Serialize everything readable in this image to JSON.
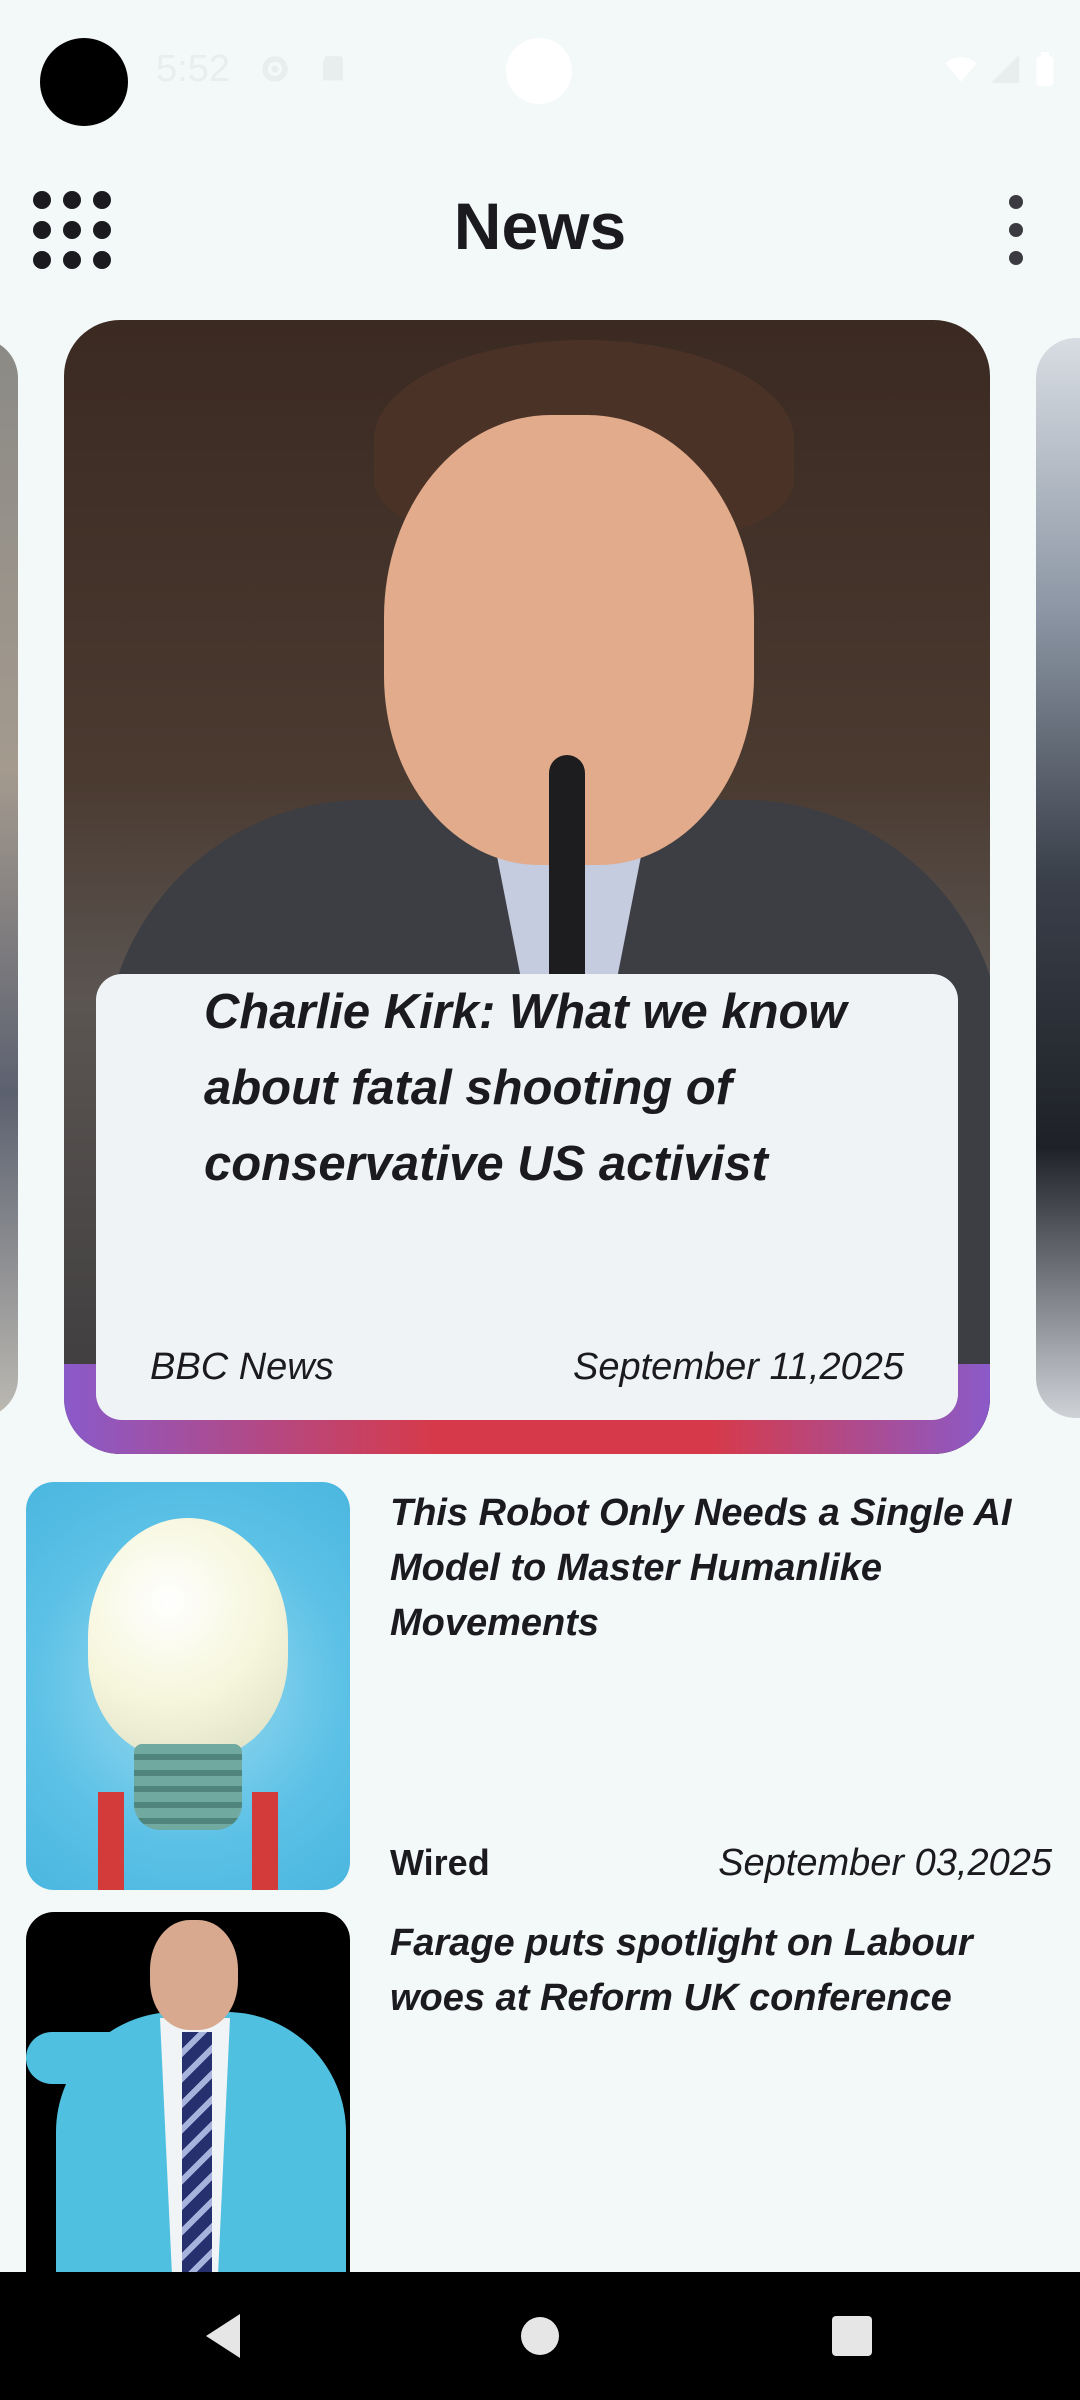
{
  "status_bar": {
    "time": "5:52",
    "icons": [
      "settings-icon",
      "sd-card-icon",
      "wifi-icon",
      "signal-icon",
      "battery-icon"
    ]
  },
  "app_bar": {
    "title": "News",
    "left_icon": "apps-grid-icon",
    "right_icon": "more-vert-icon"
  },
  "featured": {
    "title": "Charlie Kirk: What we know about fatal shooting of conservative US activist",
    "source": "BBC News",
    "date": "September 11,2025"
  },
  "articles": [
    {
      "title": "This Robot Only Needs a Single AI Model to Master Humanlike Movements",
      "source": "Wired",
      "date": "September 03,2025"
    },
    {
      "title": "Farage puts spotlight on Labour woes at Reform UK conference",
      "source": "",
      "date": ""
    }
  ],
  "nav_bar": {
    "buttons": [
      "back-icon",
      "home-icon",
      "recents-icon"
    ]
  },
  "colors": {
    "background": "#f3f8f8",
    "card_overlay": "#eff3f6",
    "text": "#1b1b1f",
    "nav_bar": "#000000"
  }
}
